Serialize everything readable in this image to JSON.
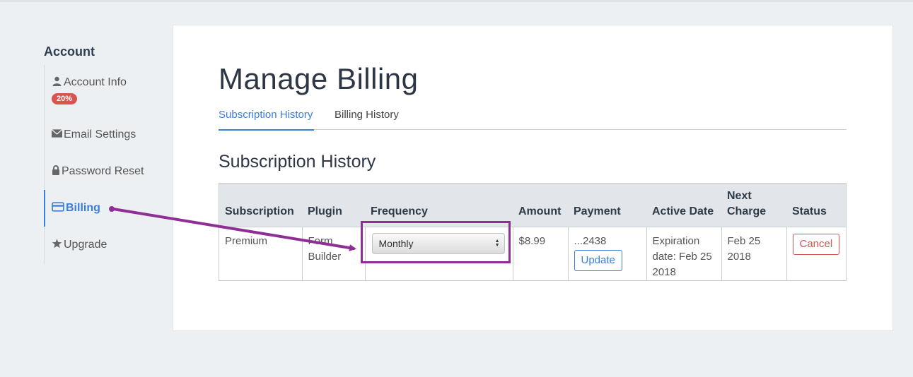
{
  "sidebar": {
    "title": "Account",
    "badge": "20%",
    "items": [
      {
        "label": "Account Info",
        "icon": "user-icon"
      },
      {
        "label": "Email Settings",
        "icon": "envelope-icon"
      },
      {
        "label": "Password Reset",
        "icon": "lock-icon"
      },
      {
        "label": "Billing",
        "icon": "credit-card-icon"
      },
      {
        "label": "Upgrade",
        "icon": "star-icon"
      }
    ]
  },
  "main": {
    "title": "Manage Billing",
    "tabs": [
      {
        "label": "Subscription History"
      },
      {
        "label": "Billing History"
      }
    ],
    "section_title": "Subscription History",
    "table": {
      "headers": [
        "Subscription",
        "Plugin",
        "Frequency",
        "Amount",
        "Payment",
        "Active Date",
        "Next Charge",
        "Status"
      ],
      "row": {
        "subscription": "Premium",
        "plugin": "Form Builder",
        "frequency": "Monthly",
        "amount": "$8.99",
        "payment": "...2438",
        "payment_button": "Update",
        "active_date": "Expiration date: Feb 25 2018",
        "next_charge": "Feb 25 2018",
        "status_button": "Cancel"
      }
    }
  },
  "colors": {
    "accent": "#3b7ddd",
    "danger": "#d9534f",
    "annotation": "#8e2f95"
  }
}
